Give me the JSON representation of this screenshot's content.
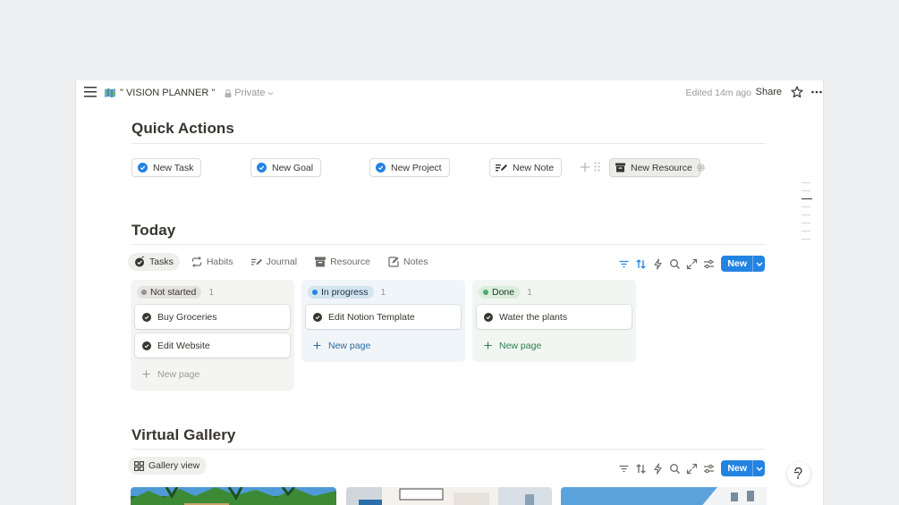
{
  "breadcrumb": {
    "title": "\" VISION PLANNER \"",
    "privacy": "Private"
  },
  "header": {
    "edited": "Edited 14m ago",
    "share": "Share"
  },
  "quick_actions": {
    "heading": "Quick Actions",
    "buttons": [
      {
        "label": "New Task",
        "icon": "check-circle-icon"
      },
      {
        "label": "New Goal",
        "icon": "check-circle-icon"
      },
      {
        "label": "New Project",
        "icon": "check-circle-icon"
      },
      {
        "label": "New Note",
        "icon": "note-pen-icon"
      },
      {
        "label": "New Resource",
        "icon": "archive-icon"
      }
    ]
  },
  "today": {
    "heading": "Today",
    "tabs": [
      {
        "label": "Tasks",
        "icon": "tasks-icon",
        "active": true
      },
      {
        "label": "Habits",
        "icon": "repeat-icon"
      },
      {
        "label": "Journal",
        "icon": "journal-pen-icon"
      },
      {
        "label": "Resource",
        "icon": "archive-icon"
      },
      {
        "label": "Notes",
        "icon": "edit-icon"
      }
    ],
    "new_button": "New",
    "columns": [
      {
        "status": "Not started",
        "count": "1",
        "dot_color": "#91918e",
        "pill_bg": "#e3e2e0",
        "pill_text": "#37352f",
        "col_bg": "#f4f4f2",
        "newpage_color": "#9b9a97",
        "cards": [
          "Buy Groceries",
          "Edit Website"
        ],
        "new_page": "New page"
      },
      {
        "status": "In progress",
        "count": "1",
        "dot_color": "#2383e2",
        "pill_bg": "#d3e5ef",
        "pill_text": "#183347",
        "col_bg": "#f0f5f9",
        "newpage_color": "#2b6aa3",
        "cards": [
          "Edit Notion Template"
        ],
        "new_page": "New page"
      },
      {
        "status": "Done",
        "count": "1",
        "dot_color": "#4daa71",
        "pill_bg": "#dbeddb",
        "pill_text": "#1c3829",
        "col_bg": "#f1f6f2",
        "newpage_color": "#2f7a4e",
        "cards": [
          "Water the plants"
        ],
        "new_page": "New page"
      }
    ]
  },
  "gallery": {
    "heading": "Virtual Gallery",
    "view_label": "Gallery view",
    "new_button": "New"
  },
  "colors": {
    "accent": "#2383e2",
    "text": "#37352f",
    "muted": "#9b9a97"
  }
}
